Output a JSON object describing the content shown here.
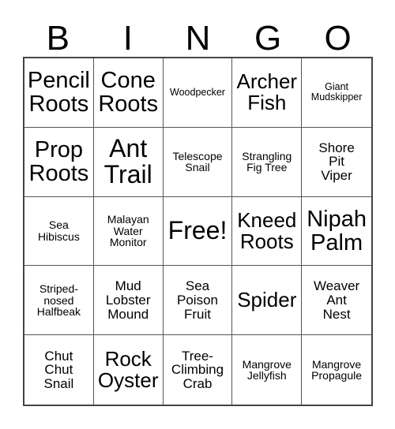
{
  "card": {
    "title_letters": [
      "B",
      "I",
      "N",
      "G",
      "O"
    ],
    "free_space_label": "Free!",
    "background_color": "#ffffff",
    "text_color": "#000000",
    "outer_border_color": "#444444",
    "inner_border_color": "#555555",
    "rows": [
      [
        {
          "label": "Pencil\nRoots",
          "size": "t-lg"
        },
        {
          "label": "Cone\nRoots",
          "size": "t-lg"
        },
        {
          "label": "Woodpecker",
          "size": "t-xxs"
        },
        {
          "label": "Archer\nFish",
          "size": "t-md"
        },
        {
          "label": "Giant\nMudskipper",
          "size": "t-xxs"
        }
      ],
      [
        {
          "label": "Prop\nRoots",
          "size": "t-lg"
        },
        {
          "label": "Ant\nTrail",
          "size": "t-xl"
        },
        {
          "label": "Telescope\nSnail",
          "size": "t-xs"
        },
        {
          "label": "Strangling\nFig Tree",
          "size": "t-xs"
        },
        {
          "label": "Shore\nPit\nViper",
          "size": "t-sm"
        }
      ],
      [
        {
          "label": "Sea\nHibiscus",
          "size": "t-xs"
        },
        {
          "label": "Malayan\nWater\nMonitor",
          "size": "t-xs"
        },
        {
          "label": "Free!",
          "size": "t-xl"
        },
        {
          "label": "Kneed\nRoots",
          "size": "t-md"
        },
        {
          "label": "Nipah\nPalm",
          "size": "t-lg"
        }
      ],
      [
        {
          "label": "Striped-\nnosed\nHalfbeak",
          "size": "t-xs"
        },
        {
          "label": "Mud\nLobster\nMound",
          "size": "t-sm"
        },
        {
          "label": "Sea\nPoison\nFruit",
          "size": "t-sm"
        },
        {
          "label": "Spider",
          "size": "t-md"
        },
        {
          "label": "Weaver\nAnt\nNest",
          "size": "t-sm"
        }
      ],
      [
        {
          "label": "Chut\nChut\nSnail",
          "size": "t-sm"
        },
        {
          "label": "Rock\nOyster",
          "size": "t-md"
        },
        {
          "label": "Tree-\nClimbing\nCrab",
          "size": "t-sm"
        },
        {
          "label": "Mangrove\nJellyfish",
          "size": "t-xs"
        },
        {
          "label": "Mangrove\nPropagule",
          "size": "t-xs"
        }
      ]
    ]
  }
}
